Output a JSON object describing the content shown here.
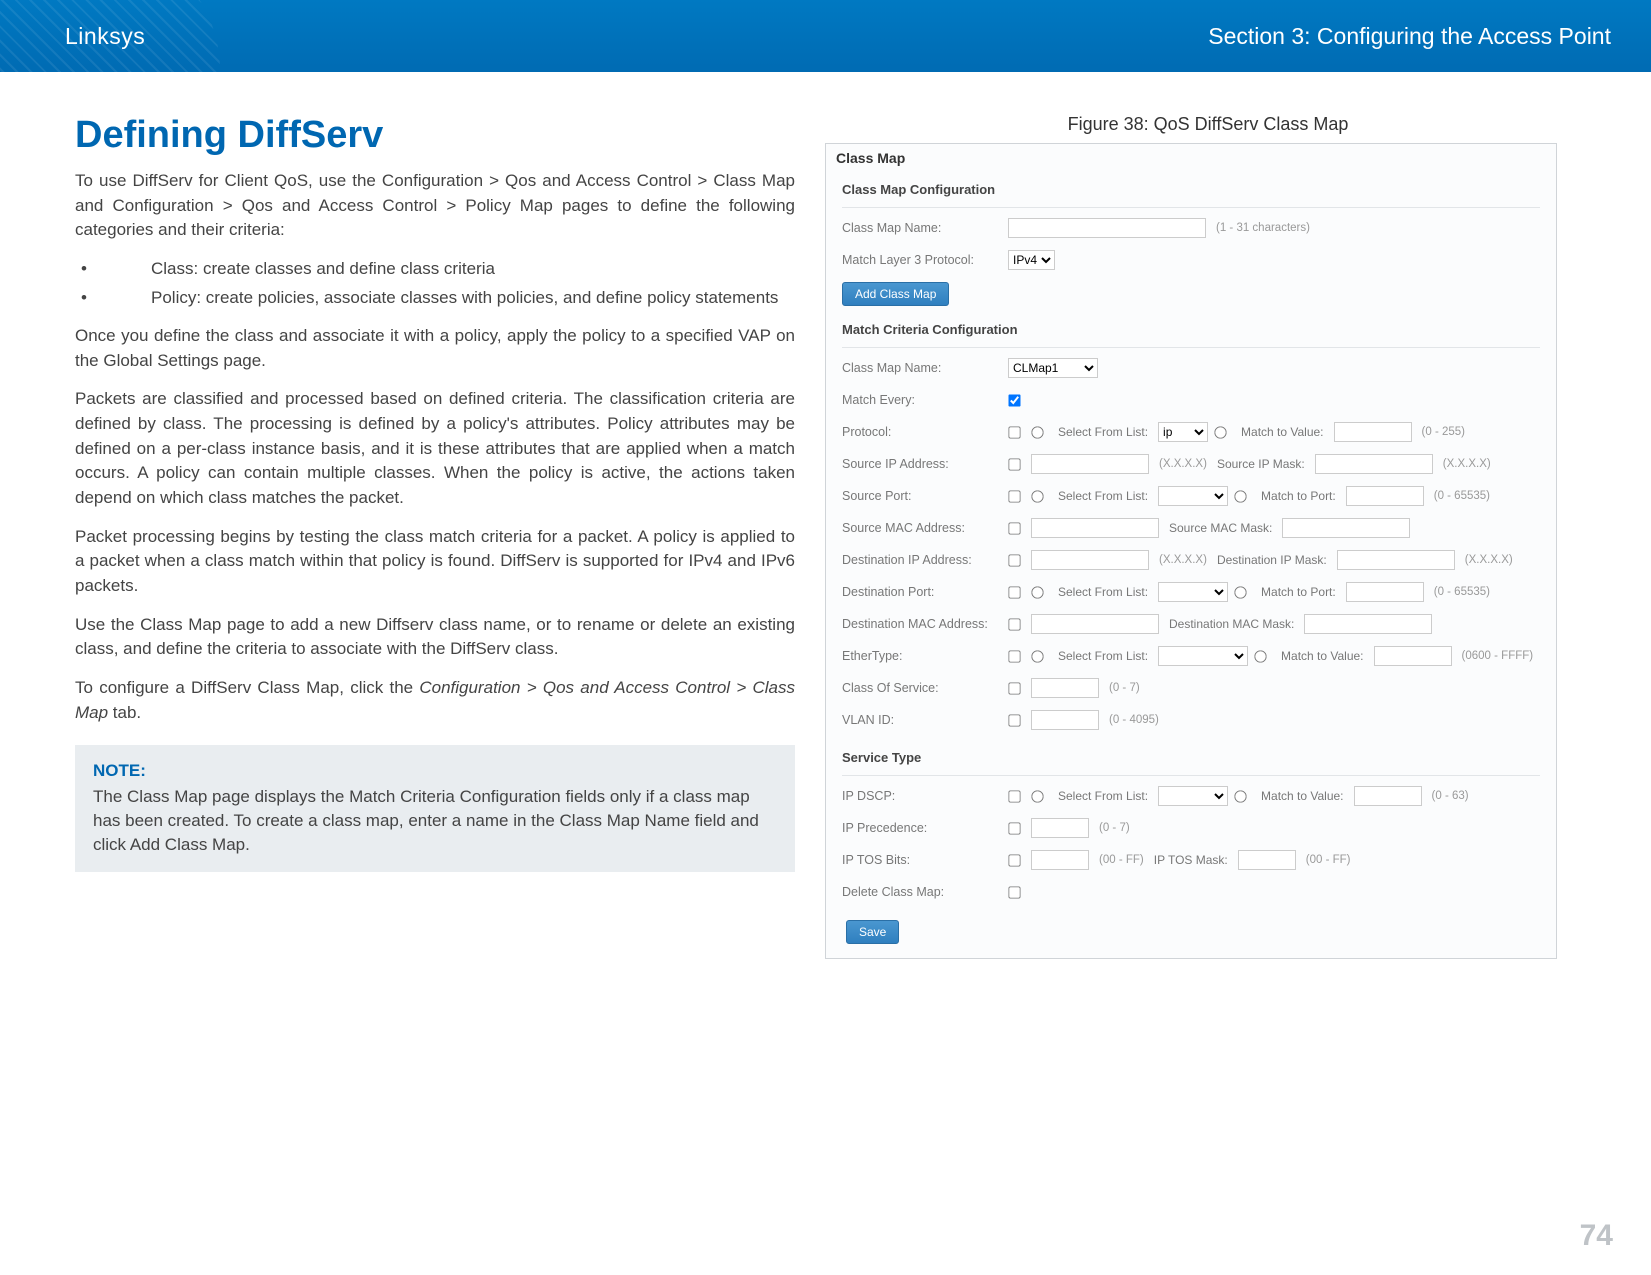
{
  "header": {
    "brand": "Linksys",
    "section": "Section 3:  Configuring the Access Point"
  },
  "title": "Defining DiffServ",
  "paragraphs": {
    "p1": "To use DiffServ for Client QoS, use the Configuration > Qos and Access Control > Class Map and Configuration > Qos and Access Control > Policy Map pages to define the following categories and their criteria:",
    "b1": "Class: create classes and define class criteria",
    "b2": "Policy: create policies, associate classes with policies, and define policy statements",
    "p2": "Once you define the class and associate it with a policy, apply the policy to a specified VAP on the Global Settings page.",
    "p3": "Packets are classified and processed based on defined criteria. The classification criteria are defined by class. The processing is defined by a policy's attributes. Policy attributes may be defined on a per-class instance basis, and it is these attributes that are applied when a match occurs. A policy can contain multiple classes. When the policy is active, the actions taken depend on which class matches the packet.",
    "p4": "Packet processing begins by testing the class match criteria for a packet. A policy is applied to a packet when a class match within that policy is found. DiffServ is supported for IPv4 and IPv6 packets.",
    "p5": "Use the Class Map page to add a new Diffserv class name, or to rename or delete an existing class, and define the criteria to associate with the DiffServ class.",
    "p6a": "To configure a DiffServ Class Map, click the ",
    "p6b": "Configuration > Qos and Access Control > Class Map",
    "p6c": " tab."
  },
  "note": {
    "label": "NOTE:",
    "text": "The Class Map page displays the Match Criteria Configuration fields only if a class map has been created. To create a class map, enter a name in the Class Map Name field and click Add Class Map."
  },
  "figure": {
    "caption": "Figure 38: QoS DiffServ Class Map",
    "panel_title": "Class Map",
    "cfg_section": "Class Map Configuration",
    "criteria_section": "Match Criteria Configuration",
    "service_section": "Service Type",
    "labels": {
      "class_map_name": "Class Map Name:",
      "match_layer3": "Match Layer 3 Protocol:",
      "match_every": "Match Every:",
      "protocol": "Protocol:",
      "src_ip": "Source IP Address:",
      "src_port": "Source Port:",
      "src_mac": "Source MAC Address:",
      "dst_ip": "Destination IP Address:",
      "dst_port": "Destination Port:",
      "dst_mac": "Destination MAC Address:",
      "ethertype": "EtherType:",
      "cos": "Class Of Service:",
      "vlan": "VLAN ID:",
      "ipdscp": "IP DSCP:",
      "ipprec": "IP Precedence:",
      "iptos": "IP TOS Bits:",
      "delete": "Delete Class Map:",
      "select_from_list": "Select From List:",
      "match_to_value": "Match to Value:",
      "match_to_port": "Match to Port:",
      "src_ip_mask": "Source IP Mask:",
      "src_mac_mask": "Source MAC Mask:",
      "dst_ip_mask": "Destination IP Mask:",
      "dst_mac_mask": "Destination MAC Mask:",
      "iptos_mask": "IP TOS Mask:"
    },
    "hints": {
      "name_range": "(1 - 31 characters)",
      "xxxx": "(X.X.X.X)",
      "r0_255": "(0 - 255)",
      "r0_65535": "(0 - 65535)",
      "r0600_ffff": "(0600 - FFFF)",
      "r0_7": "(0 - 7)",
      "r0_4095": "(0 - 4095)",
      "r0_63": "(0 - 63)",
      "r00_ff": "(00 - FF)"
    },
    "values": {
      "layer3_proto": "IPv4",
      "criteria_class": "CLMap1",
      "protocol_sel": "ip"
    },
    "buttons": {
      "add_class_map": "Add Class Map",
      "save": "Save"
    }
  },
  "page_number": "74"
}
